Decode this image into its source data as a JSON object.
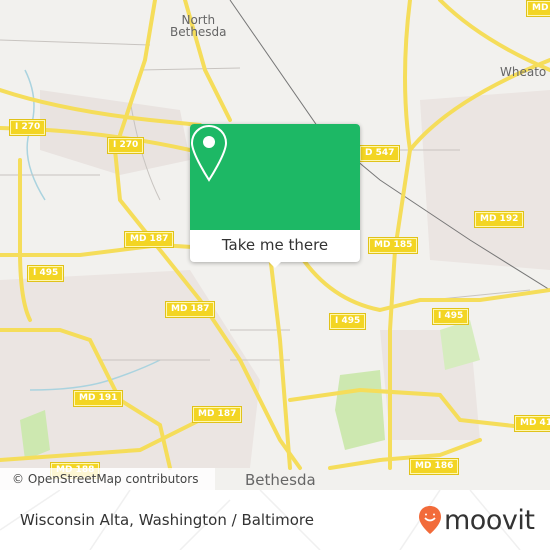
{
  "map": {
    "places": [
      {
        "name": "North Bethesda",
        "lines": [
          "North",
          "Bethesda"
        ]
      },
      {
        "name": "Wheaton",
        "lines": [
          "Wheato"
        ]
      },
      {
        "name": "Bethesda",
        "lines": [
          "Bethesda"
        ]
      }
    ],
    "road_shields": [
      "I 270",
      "I 270",
      "MD 187",
      "I 495",
      "MD 187",
      "MD 191",
      "MD 187",
      "MD 188",
      "D 547",
      "MD 192",
      "MD 185",
      "I 495",
      "I 495",
      "MD 41",
      "MD 186",
      "MD"
    ],
    "attribution": "© OpenStreetMap contributors",
    "colors": {
      "land": "#f2f1ee",
      "road": "#f5dd5a",
      "park": "#cde8b0",
      "water": "#aad3df"
    }
  },
  "popup": {
    "pin_icon": "location-pin-icon",
    "button_label": "Take me there",
    "color": "#1db865"
  },
  "footer": {
    "title": "Wisconsin Alta, Washington / Baltimore",
    "brand": "moovit",
    "brand_color": "#f26b3a"
  }
}
